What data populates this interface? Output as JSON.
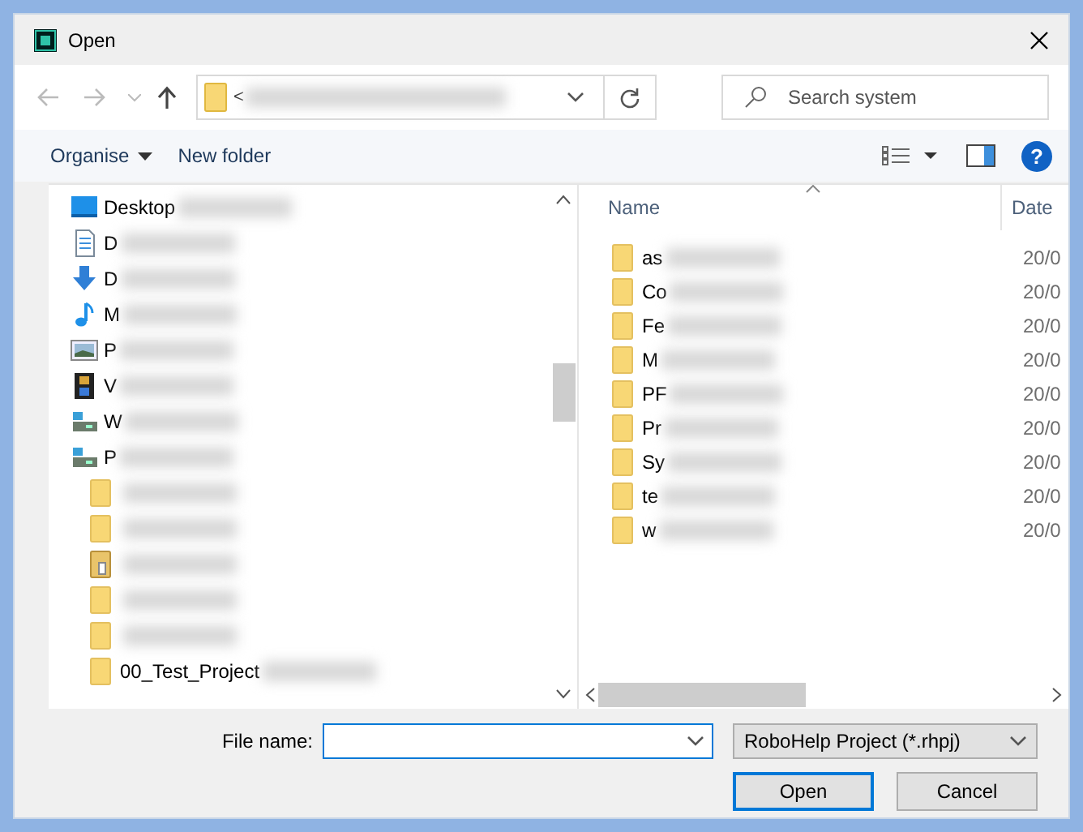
{
  "window": {
    "title": "Open"
  },
  "address_bar": {
    "path": "<"
  },
  "search": {
    "placeholder": "Search system"
  },
  "toolbar": {
    "buttons": [
      "Organise",
      "New folder"
    ],
    "help": "?"
  },
  "nav_tree": [
    {
      "label": "Desktop",
      "kind": "desktop"
    },
    {
      "label": "D",
      "kind": "documents"
    },
    {
      "label": "D",
      "kind": "downloads"
    },
    {
      "label": "M",
      "kind": "music"
    },
    {
      "label": "P",
      "kind": "pictures"
    },
    {
      "label": "V",
      "kind": "videos"
    },
    {
      "label": "W",
      "kind": "drive"
    },
    {
      "label": "P",
      "kind": "drive",
      "children": [
        {
          "kind": "folder"
        },
        {
          "kind": "folder"
        },
        {
          "kind": "shared-folder"
        },
        {
          "kind": "folder"
        },
        {
          "kind": "folder"
        },
        {
          "label": "00_Test_Project",
          "kind": "folder"
        }
      ]
    }
  ],
  "file_list": {
    "columns": [
      "Name",
      "Date"
    ],
    "rows": [
      {
        "name": "as",
        "date": "20/0"
      },
      {
        "name": "Co",
        "date": "20/0"
      },
      {
        "name": "Fe",
        "date": "20/0"
      },
      {
        "name": "M",
        "date": "20/0"
      },
      {
        "name": "PF",
        "date": "20/0"
      },
      {
        "name": "Pr",
        "date": "20/0"
      },
      {
        "name": "Sy",
        "date": "20/0"
      },
      {
        "name": "te",
        "date": "20/0"
      },
      {
        "name": "w",
        "date": "20/0"
      }
    ]
  },
  "file_name": {
    "label": "File name:"
  },
  "file_type": {
    "value": "RoboHelp Project (*.rhpj)"
  },
  "buttons": [
    {
      "label": "Open",
      "default": true
    },
    {
      "label": "Cancel",
      "default": false
    }
  ]
}
